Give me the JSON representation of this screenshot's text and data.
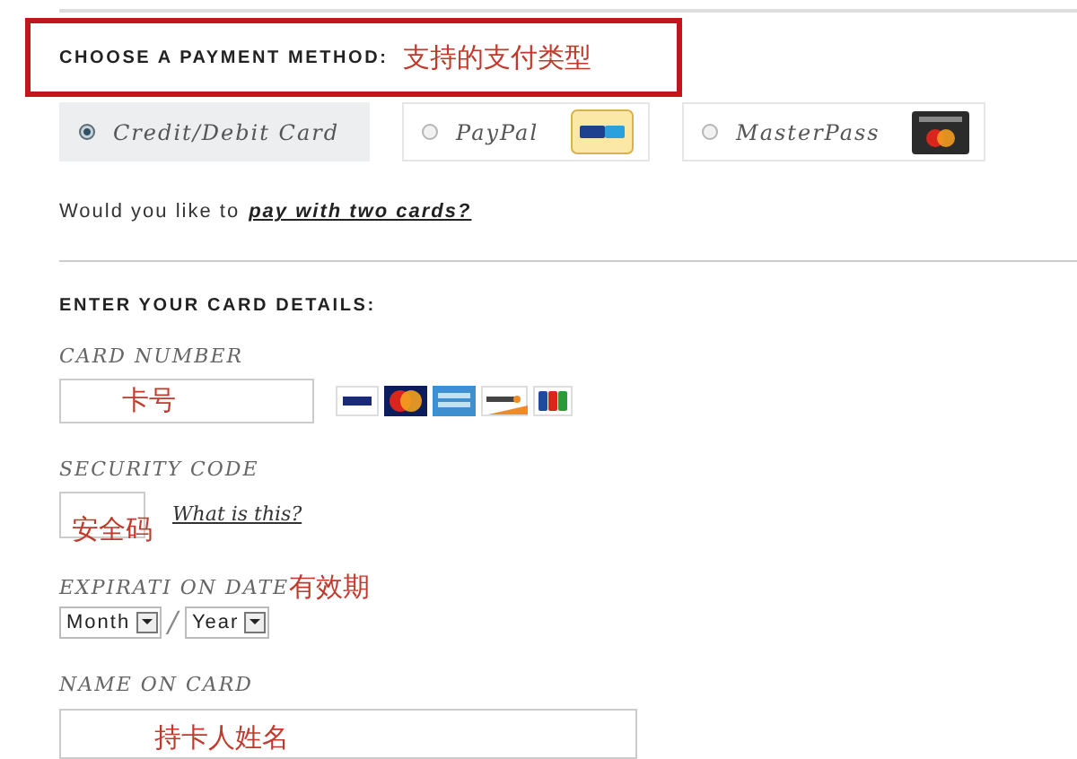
{
  "header": {
    "title": "CHOOSE A PAYMENT METHOD:",
    "annotation": "支持的支付类型"
  },
  "payment_methods": [
    {
      "label": "Credit/Debit Card",
      "selected": true,
      "kind": "card"
    },
    {
      "label": "PayPal",
      "selected": false,
      "kind": "paypal"
    },
    {
      "label": "MasterPass",
      "selected": false,
      "kind": "masterpass"
    }
  ],
  "split_prompt": {
    "text": "Would you like to",
    "link": "pay with two cards?"
  },
  "card_details": {
    "title": "ENTER YOUR CARD DETAILS:",
    "fields": [
      {
        "kind": "card_number",
        "label": "CARD NUMBER",
        "annotation": "卡号"
      },
      {
        "kind": "security",
        "label": "SECURITY CODE",
        "link": "What is this?",
        "annotation": "安全码"
      },
      {
        "kind": "expiry",
        "label": "EXPIRATI ON DATE",
        "annotation": "有效期",
        "selects": [
          "Month",
          "Year"
        ],
        "separator": "/"
      },
      {
        "kind": "name",
        "label": "NAME ON CARD",
        "annotation": "持卡人姓名"
      }
    ]
  }
}
